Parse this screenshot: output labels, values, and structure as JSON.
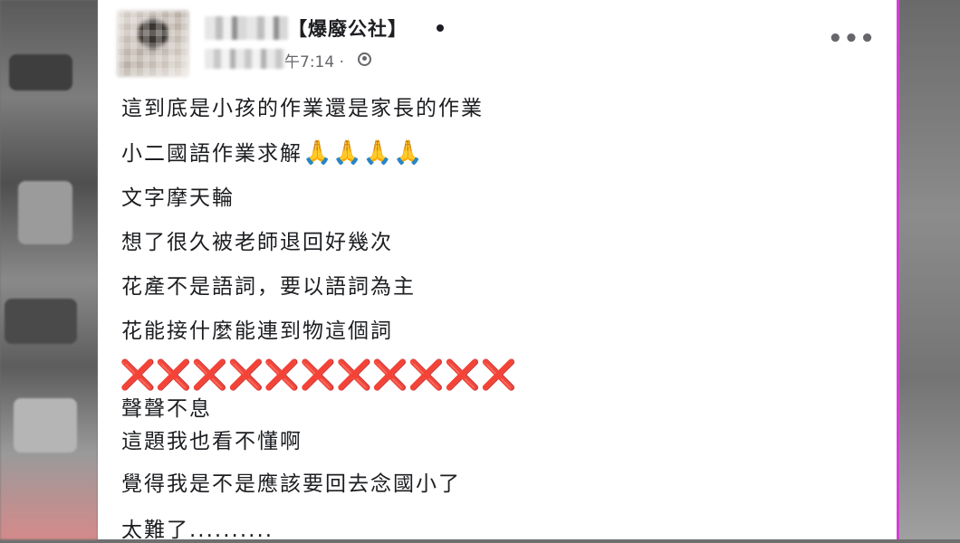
{
  "post": {
    "group_name": "【爆廢公社】",
    "timestamp": "午7:14 ·",
    "more_label": "•••",
    "lines": {
      "l1": "這到底是小孩的作業還是家長的作業",
      "l2": "小二國語作業求解",
      "l2_emoji": "🙏🙏🙏🙏",
      "l3": "文字摩天輪",
      "l4": "想了很久被老師退回好幾次",
      "l5": "花產不是語詞，要以語詞為主",
      "l6": "花能接什麼能連到物這個詞",
      "l7_crosses": "❌❌❌❌❌❌❌❌❌❌❌",
      "l8": "聲聲不息",
      "l9": "這題我也看不懂啊",
      "l10": "覺得我是不是應該要回去念國小了",
      "l11": "太難了.........."
    }
  }
}
